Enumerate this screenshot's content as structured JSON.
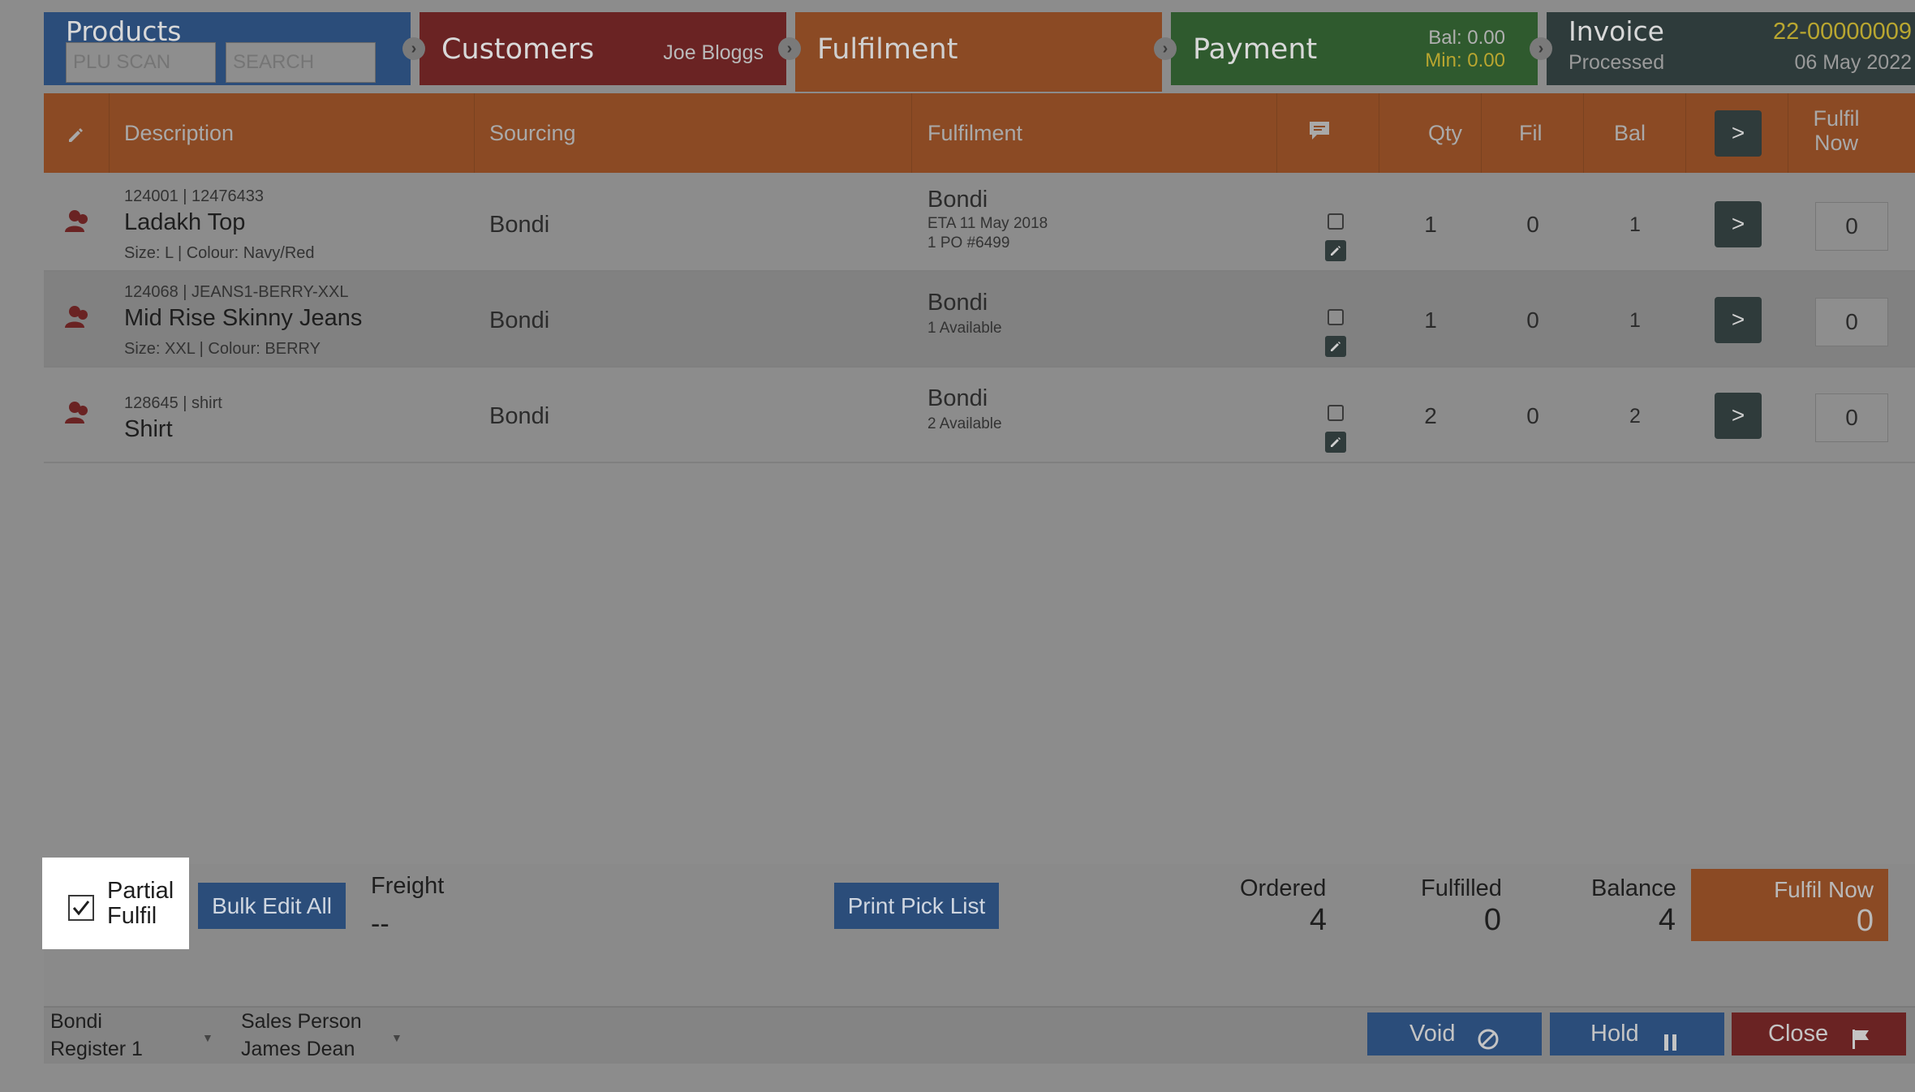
{
  "tabs": {
    "products": {
      "title": "Products",
      "plu_placeholder": "PLU SCAN",
      "search_placeholder": "SEARCH"
    },
    "customers": {
      "title": "Customers",
      "customer_name": "Joe Bloggs"
    },
    "fulfilment": {
      "title": "Fulfilment"
    },
    "payment": {
      "title": "Payment",
      "bal_label": "Bal:",
      "bal_value": "0.00",
      "min_label": "Min:",
      "min_value": "0.00"
    },
    "invoice": {
      "title": "Invoice",
      "status": "Processed",
      "number": "22-00000009",
      "date": "06 May 2022"
    }
  },
  "table": {
    "headers": {
      "description": "Description",
      "sourcing": "Sourcing",
      "fulfilment": "Fulfilment",
      "qty": "Qty",
      "fil": "Fil",
      "bal": "Bal",
      "fulfil_all_label": ">",
      "fulfil_now_line1": "Fulfil",
      "fulfil_now_line2": "Now"
    },
    "rows": [
      {
        "sku": "124001 | 12476433",
        "name": "Ladakh Top",
        "attrs": "Size: L | Colour: Navy/Red",
        "sourcing": "Bondi",
        "fulfil_location": "Bondi",
        "fulfil_sub1": "ETA 11 May 2018",
        "fulfil_sub2": "1 PO #6499",
        "qty": "1",
        "fil": "0",
        "bal": "1",
        "arrow": ">",
        "fulfil_now": "0"
      },
      {
        "sku": "124068 | JEANS1-BERRY-XXL",
        "name": "Mid Rise Skinny Jeans",
        "attrs": "Size: XXL | Colour: BERRY",
        "sourcing": "Bondi",
        "fulfil_location": "Bondi",
        "fulfil_sub1": "1 Available",
        "qty": "1",
        "fil": "0",
        "bal": "1",
        "arrow": ">",
        "fulfil_now": "0"
      },
      {
        "sku": "128645 | shirt",
        "name": "Shirt",
        "sourcing": "Bondi",
        "fulfil_location": "Bondi",
        "fulfil_sub1": "2 Available",
        "qty": "2",
        "fil": "0",
        "bal": "2",
        "arrow": ">",
        "fulfil_now": "0"
      }
    ]
  },
  "summary": {
    "partial_fulfil_line1": "Partial",
    "partial_fulfil_line2": "Fulfil",
    "partial_fulfil_checked": true,
    "bulk_edit_label": "Bulk Edit All",
    "freight_label": "Freight",
    "freight_value": "--",
    "print_pick_list_label": "Print Pick List",
    "ordered_label": "Ordered",
    "ordered_value": "4",
    "fulfilled_label": "Fulfilled",
    "fulfilled_value": "0",
    "balance_label": "Balance",
    "balance_value": "4",
    "fulfil_now_label": "Fulfil Now",
    "fulfil_now_value": "0"
  },
  "bottom_bar": {
    "store": "Bondi",
    "register": "Register 1",
    "sales_person_label": "Sales Person",
    "sales_person_name": "James Dean",
    "void_label": "Void",
    "hold_label": "Hold",
    "close_label": "Close"
  },
  "colors": {
    "products_blue": "#2b4d7a",
    "customers_red": "#6a2323",
    "fulfilment_orange": "#8b4a24",
    "payment_green": "#2f5a2e",
    "invoice_dark": "#2e3b3b",
    "accent_yellow": "#b9a630"
  }
}
